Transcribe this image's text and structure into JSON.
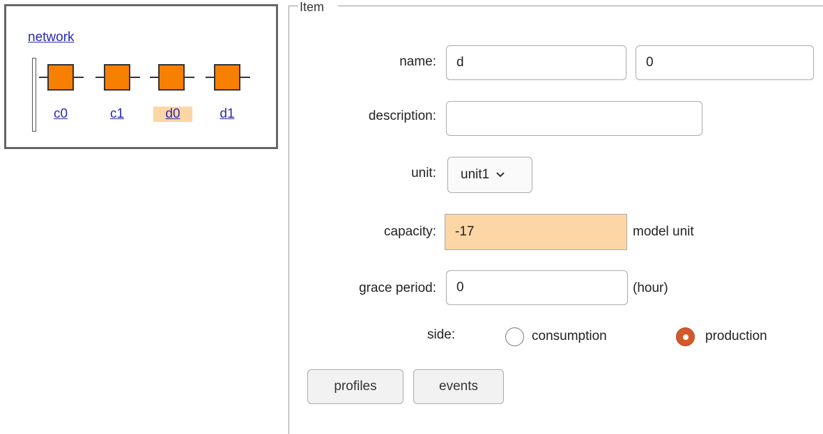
{
  "network": {
    "title": "network",
    "nodes": [
      {
        "label": "c0",
        "selected": false
      },
      {
        "label": "c1",
        "selected": false
      },
      {
        "label": "d0",
        "selected": true
      },
      {
        "label": "d1",
        "selected": false
      }
    ],
    "colors": {
      "node_fill": "#f78000",
      "selected_label_bg": "#fcd6a4",
      "link": "#2a2ab0"
    }
  },
  "item": {
    "legend": "Item",
    "name_label": "name:",
    "name_value": "d",
    "name_index": "0",
    "description_label": "description:",
    "description_value": "",
    "unit_label": "unit:",
    "unit_value": "unit1",
    "capacity_label": "capacity:",
    "capacity_value": "-17",
    "capacity_unit": "model unit",
    "grace_label": "grace period:",
    "grace_value": "0",
    "grace_unit": "(hour)",
    "side_label": "side:",
    "side_options": [
      "consumption",
      "production"
    ],
    "side_selected": "production",
    "profiles_button": "profiles",
    "events_button": "events",
    "colors": {
      "highlight": "#fcd6a4",
      "radio_on": "#d4582a"
    }
  }
}
